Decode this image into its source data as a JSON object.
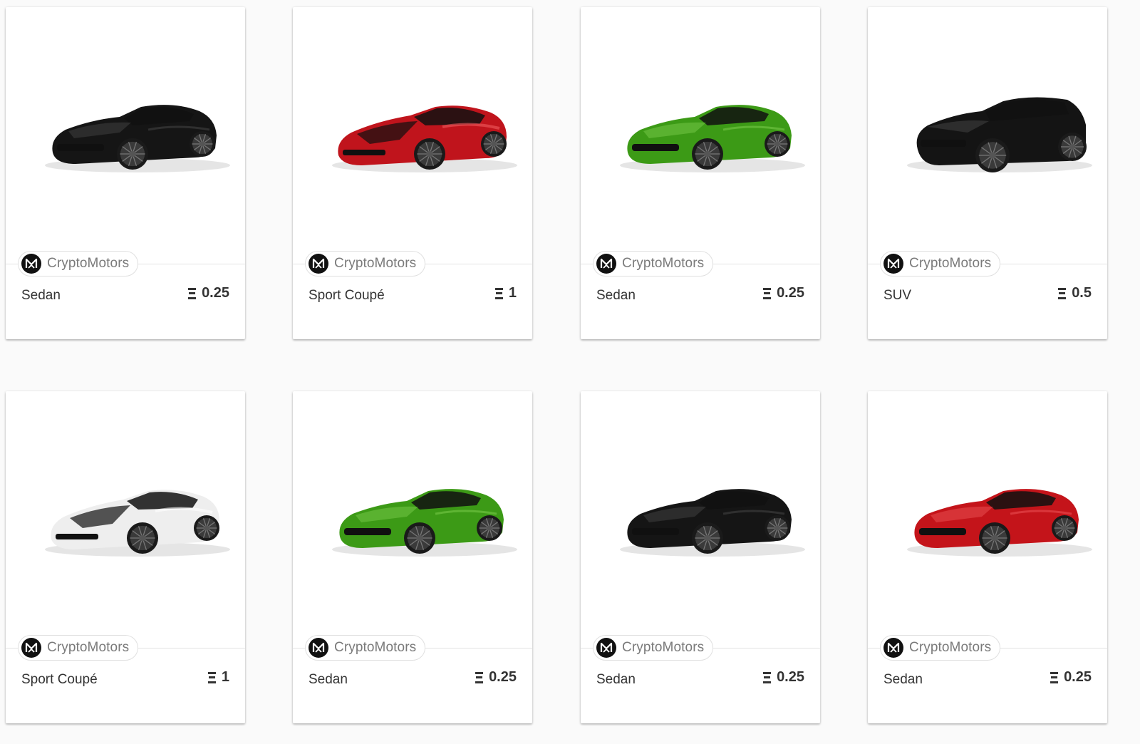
{
  "brand": {
    "name": "CryptoMotors"
  },
  "cars": [
    {
      "type": "Sedan",
      "price": "0.25",
      "body": "sedan",
      "color": "#151515",
      "highlight": "#4a4a4a"
    },
    {
      "type": "Sport Coupé",
      "price": "1",
      "body": "sport",
      "color": "#c0141c",
      "highlight": "#ee5a5e"
    },
    {
      "type": "Sedan",
      "price": "0.25",
      "body": "sedan",
      "color": "#3c9a16",
      "highlight": "#7fd04f"
    },
    {
      "type": "SUV",
      "price": "0.5",
      "body": "suv",
      "color": "#141414",
      "highlight": "#4c4c4c"
    },
    {
      "type": "Sport Coupé",
      "price": "1",
      "body": "sport",
      "color": "#eeeeee",
      "highlight": "#ffffff"
    },
    {
      "type": "Sedan",
      "price": "0.25",
      "body": "sedan",
      "color": "#3c9a16",
      "highlight": "#7fd04f"
    },
    {
      "type": "Sedan",
      "price": "0.25",
      "body": "sedan",
      "color": "#151515",
      "highlight": "#4a4a4a"
    },
    {
      "type": "Sedan",
      "price": "0.25",
      "body": "sedan",
      "color": "#c4141a",
      "highlight": "#f0585c"
    }
  ]
}
